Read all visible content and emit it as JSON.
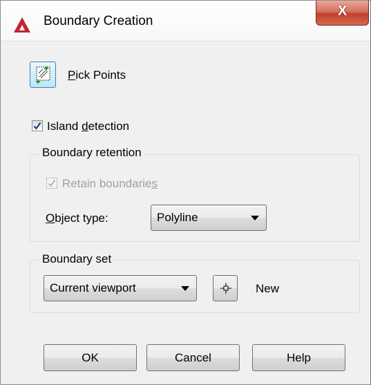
{
  "window": {
    "title": "Boundary Creation",
    "close_label": "X"
  },
  "pick_points": {
    "label_prefix": "P",
    "label_rest": "ick Points"
  },
  "island_detection": {
    "checked": true,
    "label_prefix": "Island ",
    "label_underlined": "d",
    "label_rest": "etection"
  },
  "boundary_retention": {
    "title": "Boundary retention",
    "retain_boundaries": {
      "checked": true,
      "disabled": true,
      "label_prefix": "Retain boundarie",
      "label_underlined": "s"
    },
    "object_type": {
      "label_underlined": "O",
      "label_rest": "bject type:",
      "value": "Polyline"
    }
  },
  "boundary_set": {
    "title": "Boundary set",
    "value": "Current viewport",
    "new_label": "New"
  },
  "buttons": {
    "ok": "OK",
    "cancel": "Cancel",
    "help": "Help"
  },
  "colors": {
    "accent_red": "#c0262c",
    "checkmark_blue": "#1c3e8e",
    "dialog_bg": "#f0f0f0"
  }
}
